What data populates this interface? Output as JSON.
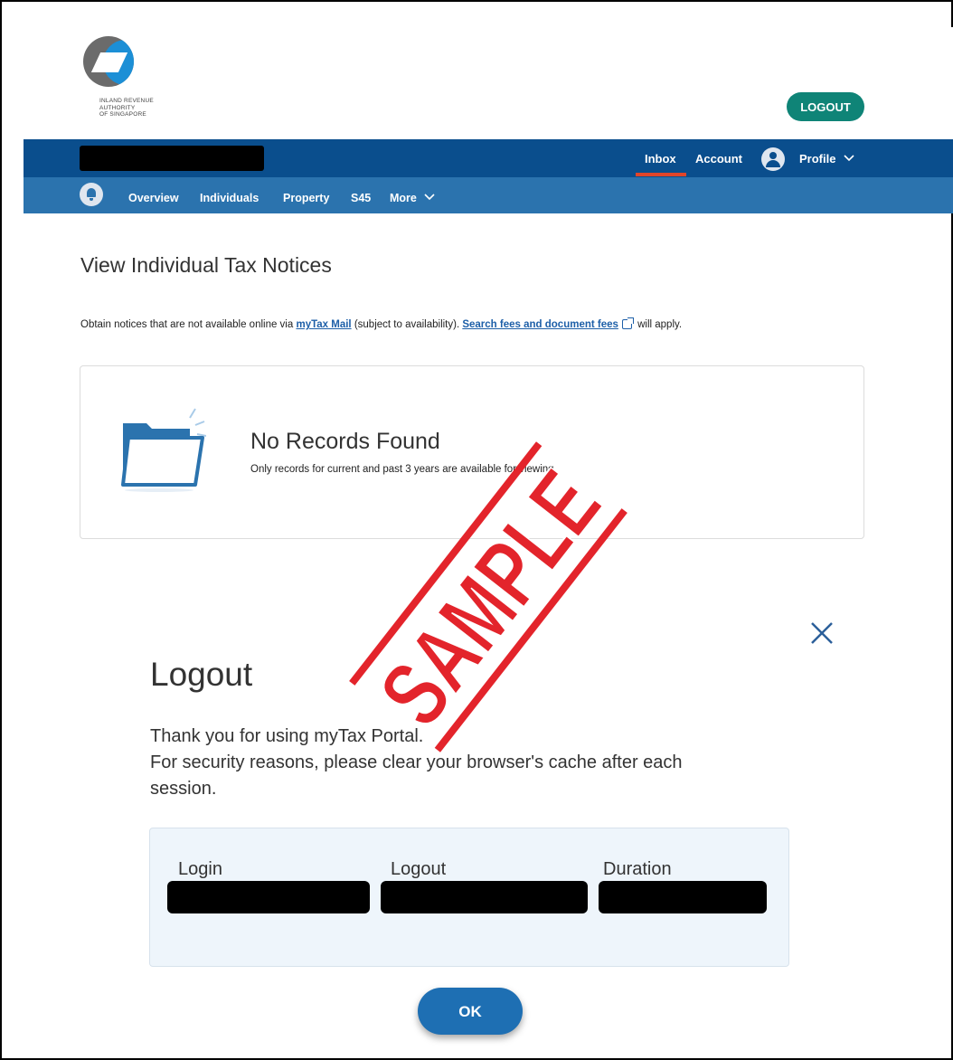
{
  "header": {
    "logo_text": [
      "INLAND REVENUE",
      "AUTHORITY",
      "OF SINGAPORE"
    ],
    "logout_label": "LOGOUT"
  },
  "navbar": {
    "inbox": "Inbox",
    "account": "Account",
    "profile": "Profile"
  },
  "subnav": {
    "items": [
      "Overview",
      "Individuals",
      "Property",
      "S45",
      "More"
    ]
  },
  "page": {
    "title": "View Individual Tax Notices",
    "info_prefix": "Obtain notices that are not available online via ",
    "info_link1": "myTax Mail",
    "info_middle": " (subject to availability). ",
    "info_link2": "Search fees and document fees",
    "info_suffix": " will apply."
  },
  "records": {
    "title": "No Records Found",
    "subtitle": "Only records for current and past 3 years are available for viewing."
  },
  "modal": {
    "title": "Logout",
    "line1": "Thank you for using myTax Portal.",
    "line2": "For security reasons, please clear your browser's cache after each session.",
    "login_label": "Login",
    "logout_label": "Logout",
    "duration_label": "Duration",
    "ok_label": "OK"
  },
  "watermark": {
    "text": "SAMPLE",
    "color": "#e3242b"
  },
  "colors": {
    "navbar": "#0a4e8d",
    "subnav": "#2b73ae",
    "logout_button": "#0f8477",
    "ok_button": "#1e6fb3",
    "link": "#1d5fa8"
  }
}
